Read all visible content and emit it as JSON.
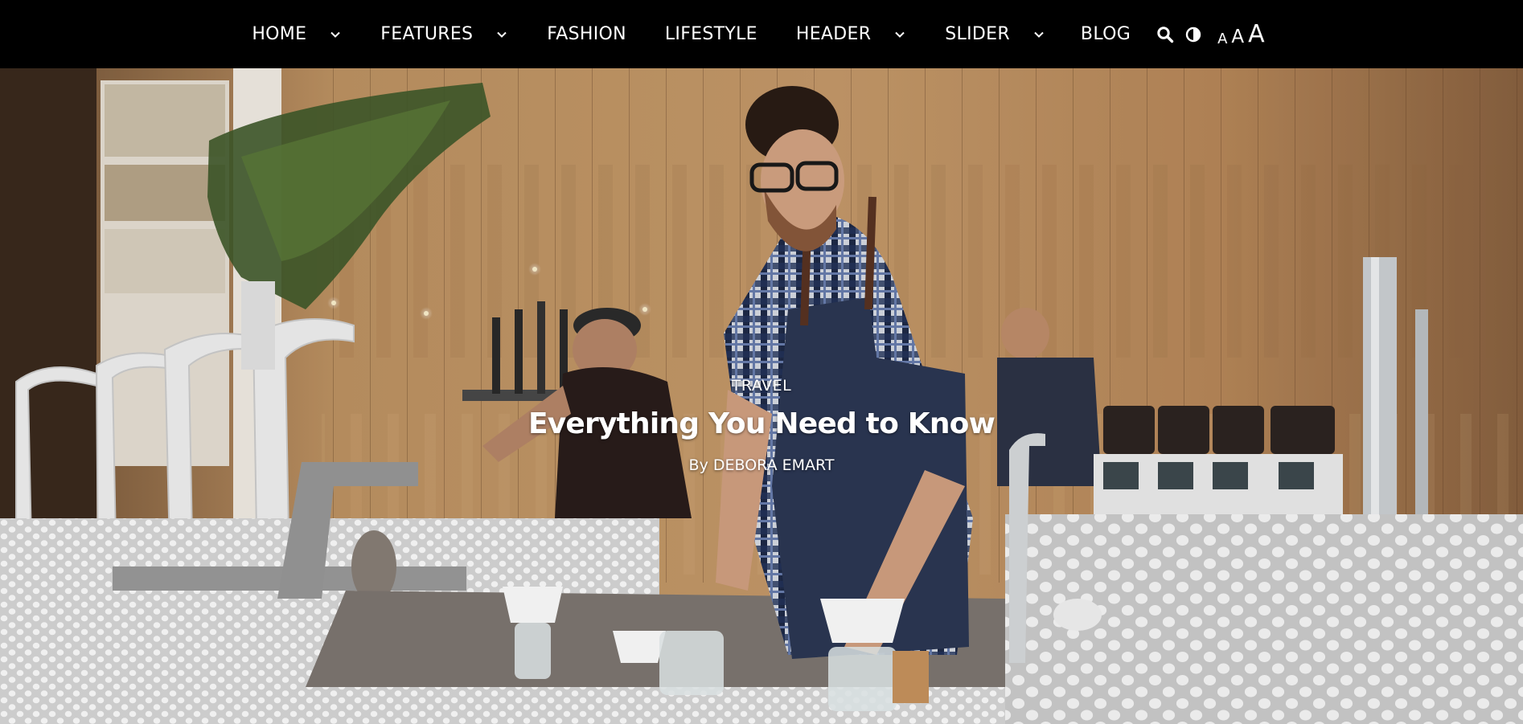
{
  "nav": {
    "items": [
      {
        "label": "HOME",
        "has_dropdown": true
      },
      {
        "label": "FEATURES",
        "has_dropdown": true
      },
      {
        "label": "FASHION",
        "has_dropdown": false
      },
      {
        "label": "LIFESTYLE",
        "has_dropdown": false
      },
      {
        "label": "HEADER",
        "has_dropdown": true
      },
      {
        "label": "SLIDER",
        "has_dropdown": true
      },
      {
        "label": "BLOG",
        "has_dropdown": false
      }
    ],
    "tools": {
      "search_icon": "search-icon",
      "contrast_icon": "contrast-icon",
      "font_small": "A",
      "font_medium": "A",
      "font_large": "A"
    }
  },
  "hero": {
    "category": "TRAVEL",
    "title": "Everything You Need to Know",
    "byline_prefix": "By",
    "author": "DEBORA EMART"
  },
  "colors": {
    "nav_bg": "#000000",
    "nav_text": "#ffffff",
    "hero_text": "#ffffff"
  }
}
